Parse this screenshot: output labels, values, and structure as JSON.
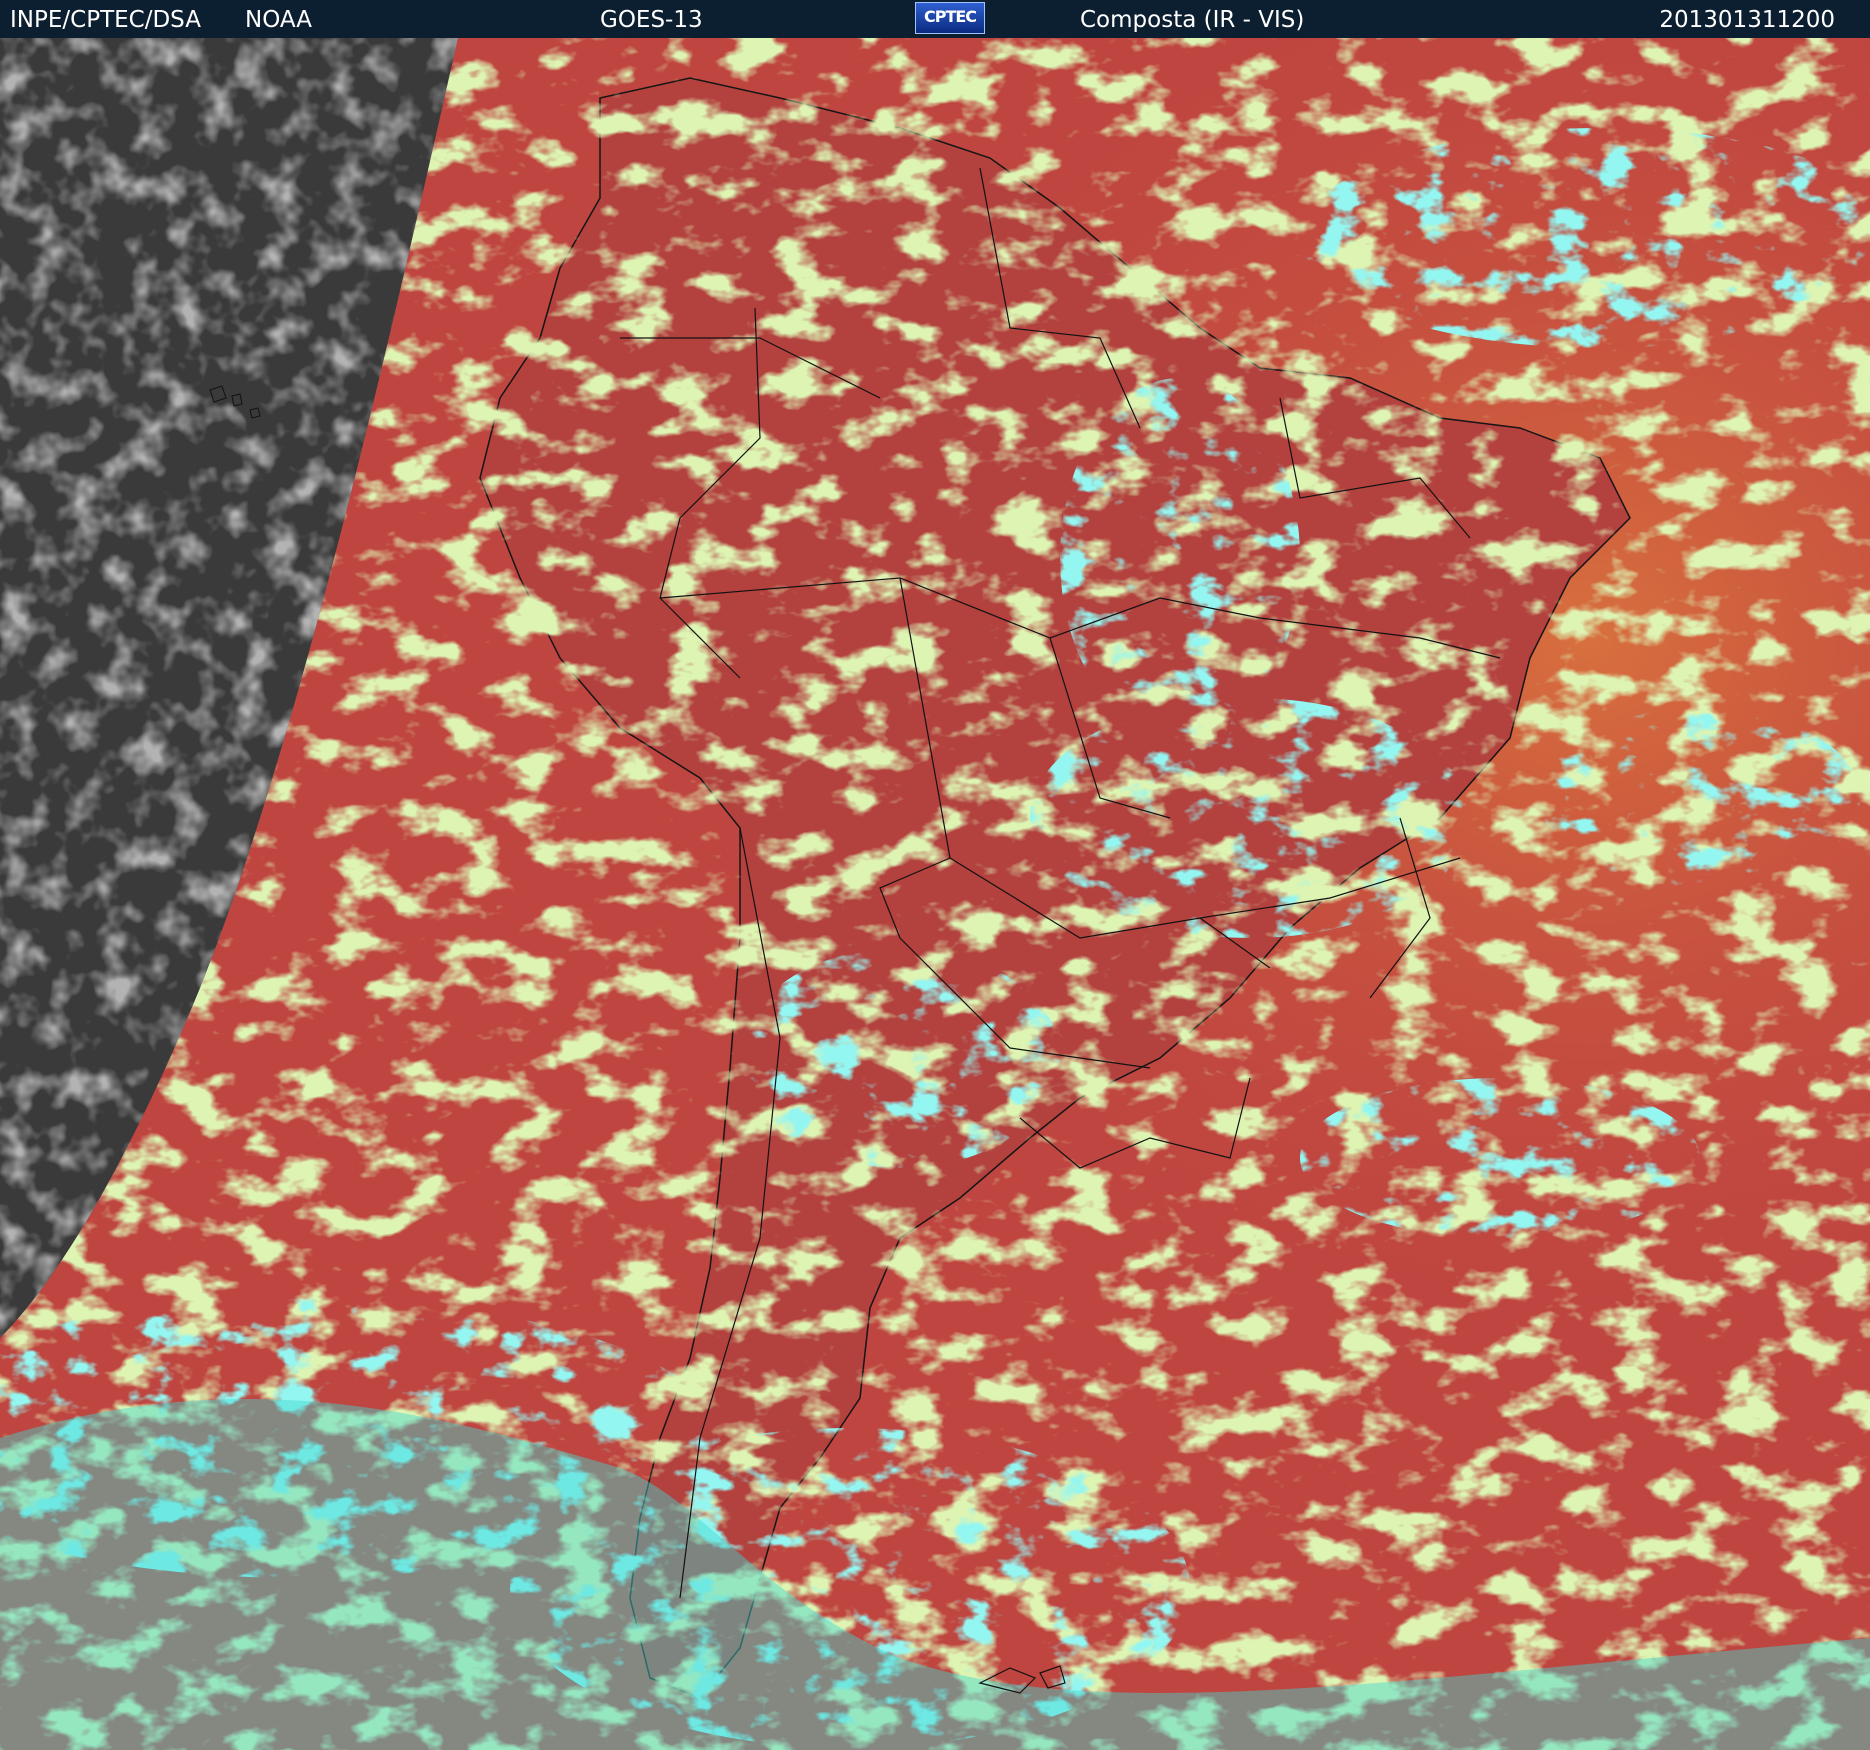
{
  "header": {
    "organization": "INPE/CPTEC/DSA",
    "agency": "NOAA",
    "satellite": "GOES-13",
    "logo_text": "CPTEC",
    "product": "Composta (IR - VIS)",
    "timestamp": "201301311200"
  },
  "colors": {
    "header_bg": "#0c1f30",
    "land_clear": "#b8413c",
    "ocean_clear": "#c4483e",
    "low_cloud": "#b9e05a",
    "high_cloud": "#3fe8e0",
    "night_side": "#3a3a3a",
    "borders": "#111111"
  }
}
